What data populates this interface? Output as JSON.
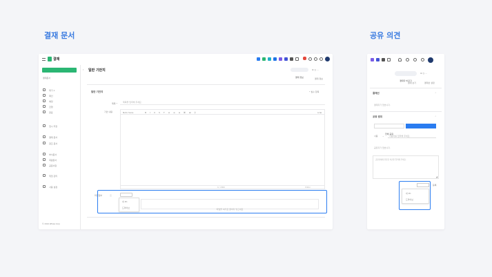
{
  "headings": {
    "left": "결재 문서",
    "right": "공유 의견"
  },
  "left_panel": {
    "app_title": "결재",
    "new_doc_button": "결재 작성",
    "sidebar_group": "결재문서",
    "sidebar_items": [
      "대기 1",
      "확인",
      "예정",
      "진행",
      "완료",
      "임시 저장",
      "결재 문서",
      "참조 문서",
      "부서문서",
      "회람문서",
      "공문서함",
      "위임 관리",
      "사용 설정"
    ],
    "footer": "© 2024 Whale Corp",
    "doc_title": "일반 기안지",
    "header_pill": "결재 정보",
    "header_sub": "결재 정보",
    "form_title": "일반 기안지",
    "form_required": "* 필수 항목",
    "field_title_label": "제목 *",
    "field_title_placeholder": "제목을 입력해 주세요.",
    "field_content_label": "기안 내용",
    "editor_font": "Noto Sans",
    "attach_label": "파일첨부",
    "attach_button": "파일 첨부",
    "attach_hint": "파일을 여기로 끌어다 놓으세요",
    "attach_menu": [
      "내 PC",
      "드라이브"
    ],
    "editor_count": "0 / 2000",
    "editor_mode": "Editor"
  },
  "right_panel": {
    "pill_label": "결재자 바꾸기",
    "link_left": "결재 보기",
    "link_right": "결재선 설정",
    "section_approval": "결재선",
    "approval_empty": "결재자가 없습니다.",
    "section_share": "공유 범위",
    "tab_all": "전체 공유",
    "tab_partial": "일부 공유",
    "select_label": "사용",
    "select_placeholder": "사용자를 입력해 주세요.",
    "share_empty": "공유자가 없습니다.",
    "textarea_placeholder": "공유자에게 전달할 의견을 입력해 주세요.",
    "attach_button": "파일 첨부",
    "attach_send": "등록",
    "attach_menu": [
      "내 PC",
      "드라이브"
    ]
  },
  "colors": {
    "accent": "#2a7cf0",
    "brand_green": "#2bb673",
    "heading": "#3a7be0"
  }
}
